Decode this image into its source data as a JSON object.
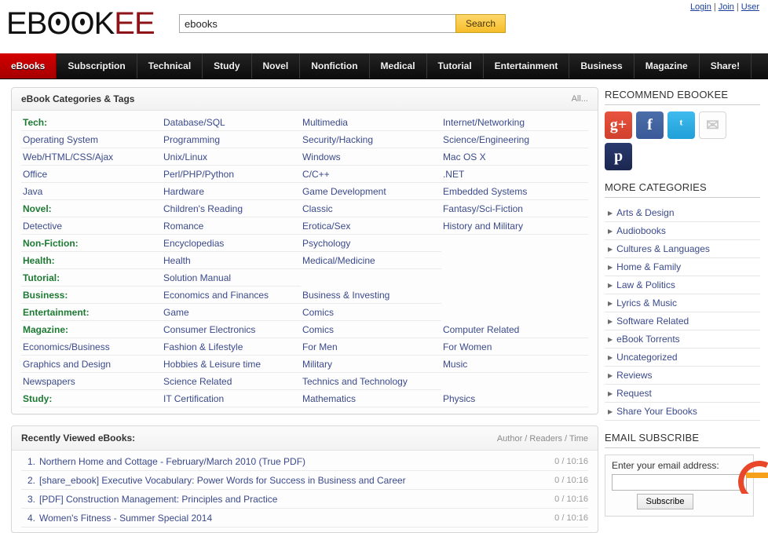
{
  "header": {
    "logo_black": "EBOOK",
    "logo_red": "EE",
    "search_value": "ebooks",
    "search_placeholder": "",
    "search_button": "Search",
    "top_links": [
      "Login",
      "Join",
      "User"
    ],
    "link_separator": "|"
  },
  "nav": {
    "items": [
      {
        "label": "eBooks",
        "active": true
      },
      {
        "label": "Subscription",
        "active": false
      },
      {
        "label": "Technical",
        "active": false
      },
      {
        "label": "Study",
        "active": false
      },
      {
        "label": "Novel",
        "active": false
      },
      {
        "label": "Nonfiction",
        "active": false
      },
      {
        "label": "Medical",
        "active": false
      },
      {
        "label": "Tutorial",
        "active": false
      },
      {
        "label": "Entertainment",
        "active": false
      },
      {
        "label": "Business",
        "active": false
      },
      {
        "label": "Magazine",
        "active": false
      },
      {
        "label": "Share!",
        "active": false
      }
    ]
  },
  "categories_panel": {
    "title": "eBook Categories & Tags",
    "all_link": "All...",
    "rows": [
      [
        {
          "t": "Tech:",
          "head": true
        },
        {
          "t": "Database/SQL"
        },
        {
          "t": "Multimedia"
        },
        {
          "t": "Internet/Networking"
        }
      ],
      [
        {
          "t": "Operating System"
        },
        {
          "t": "Programming"
        },
        {
          "t": "Security/Hacking"
        },
        {
          "t": "Science/Engineering"
        }
      ],
      [
        {
          "t": "Web/HTML/CSS/Ajax"
        },
        {
          "t": "Unix/Linux"
        },
        {
          "t": "Windows"
        },
        {
          "t": "Mac OS X"
        }
      ],
      [
        {
          "t": "Office"
        },
        {
          "t": "Perl/PHP/Python"
        },
        {
          "t": "C/C++"
        },
        {
          "t": ".NET"
        }
      ],
      [
        {
          "t": "Java"
        },
        {
          "t": "Hardware"
        },
        {
          "t": "Game Development"
        },
        {
          "t": "Embedded Systems"
        }
      ],
      [
        {
          "t": "Novel:",
          "head": true
        },
        {
          "t": "Children's Reading"
        },
        {
          "t": "Classic"
        },
        {
          "t": "Fantasy/Sci-Fiction"
        }
      ],
      [
        {
          "t": "Detective"
        },
        {
          "t": "Romance"
        },
        {
          "t": "Erotica/Sex"
        },
        {
          "t": "History and Military"
        }
      ],
      [
        {
          "t": "Non-Fiction:",
          "head": true
        },
        {
          "t": "Encyclopedias"
        },
        {
          "t": "Psychology"
        },
        {
          "t": ""
        }
      ],
      [
        {
          "t": "Health:",
          "head": true
        },
        {
          "t": "Health"
        },
        {
          "t": "Medical/Medicine"
        },
        {
          "t": ""
        }
      ],
      [
        {
          "t": "Tutorial:",
          "head": true
        },
        {
          "t": "Solution Manual"
        },
        {
          "t": ""
        },
        {
          "t": ""
        }
      ],
      [
        {
          "t": "Business:",
          "head": true
        },
        {
          "t": "Economics and Finances"
        },
        {
          "t": "Business & Investing"
        },
        {
          "t": ""
        }
      ],
      [
        {
          "t": "Entertainment:",
          "head": true
        },
        {
          "t": "Game"
        },
        {
          "t": "Comics"
        },
        {
          "t": ""
        }
      ],
      [
        {
          "t": "Magazine:",
          "head": true
        },
        {
          "t": "Consumer Electronics"
        },
        {
          "t": "Comics"
        },
        {
          "t": "Computer Related"
        }
      ],
      [
        {
          "t": "Economics/Business"
        },
        {
          "t": "Fashion & Lifestyle"
        },
        {
          "t": "For Men"
        },
        {
          "t": "For Women"
        }
      ],
      [
        {
          "t": "Graphics and Design"
        },
        {
          "t": "Hobbies & Leisure time"
        },
        {
          "t": "Military"
        },
        {
          "t": "Music"
        }
      ],
      [
        {
          "t": "Newspapers"
        },
        {
          "t": "Science Related"
        },
        {
          "t": "Technics and Technology"
        },
        {
          "t": ""
        }
      ],
      [
        {
          "t": "Study:",
          "head": true
        },
        {
          "t": "IT Certification"
        },
        {
          "t": "Mathematics"
        },
        {
          "t": "Physics"
        }
      ]
    ]
  },
  "recent_panel": {
    "title": "Recently Viewed eBooks:",
    "columns_label": "Author / Readers / Time",
    "items": [
      {
        "num": "1.",
        "title": "Northern Home and Cottage - February/March 2010 (True PDF)",
        "meta": "0 / 10:16"
      },
      {
        "num": "2.",
        "title": "[share_ebook] Executive Vocabulary: Power Words for Success in Business and Career",
        "meta": "0 / 10:16"
      },
      {
        "num": "3.",
        "title": "[PDF] Construction Management: Principles and Practice",
        "meta": "0 / 10:16"
      },
      {
        "num": "4.",
        "title": "Women's Fitness - Summer Special 2014",
        "meta": "0 / 10:16"
      }
    ]
  },
  "sidebar": {
    "recommend_heading": "RECOMMEND EBOOKEE",
    "social": [
      {
        "name": "google-plus-icon",
        "glyph": "g+"
      },
      {
        "name": "facebook-icon",
        "glyph": "f"
      },
      {
        "name": "twitter-icon",
        "glyph": "ᵗ"
      },
      {
        "name": "email-icon",
        "glyph": "✉"
      },
      {
        "name": "pinterest-icon",
        "glyph": "p"
      }
    ],
    "more_heading": "MORE CATEGORIES",
    "more_items": [
      "Arts & Design",
      "Audiobooks",
      "Cultures & Languages",
      "Home & Family",
      "Law & Politics",
      "Lyrics & Music",
      "Software Related",
      "eBook Torrents",
      "Uncategorized",
      "Reviews",
      "Request",
      "Share Your Ebooks"
    ],
    "subscribe_heading": "EMAIL SUBSCRIBE",
    "subscribe_label": "Enter your email address:",
    "subscribe_value": "",
    "subscribe_placeholder": "",
    "subscribe_button": "Subscribe"
  }
}
